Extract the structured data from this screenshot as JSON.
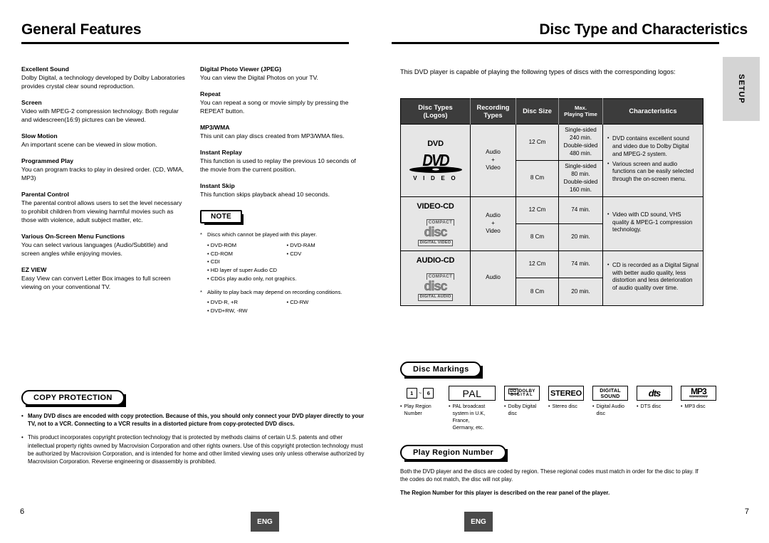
{
  "left_page": {
    "title": "General Features",
    "page_number": "6",
    "lang_tag": "ENG",
    "column1": [
      {
        "heading": "Excellent Sound",
        "body": "Dolby Digital, a technology developed by Dolby Laboratories provides crystal clear sound reproduction."
      },
      {
        "heading": "Screen",
        "body": "Video with MPEG-2 compression technology. Both regular and widescreen(16:9) pictures can be viewed."
      },
      {
        "heading": "Slow Motion",
        "body": "An important scene can be viewed in slow motion."
      },
      {
        "heading": "Programmed Play",
        "body": "You can program tracks to play in desired order. (CD, WMA, MP3)"
      },
      {
        "heading": "Parental Control",
        "body": "The parental control allows users to set the level necessary to prohibit children from viewing harmful movies such as those with violence, adult subject matter, etc."
      },
      {
        "heading": "Various On-Screen Menu Functions",
        "body": "You can select various languages (Audio/Subtitle) and screen angles while enjoying movies."
      },
      {
        "heading": "EZ VIEW",
        "body": "Easy View can convert Letter Box images to full screen viewing on your conventional TV."
      }
    ],
    "column2": [
      {
        "heading": "Digital Photo Viewer (JPEG)",
        "body": "You can view the Digital Photos on your TV."
      },
      {
        "heading": "Repeat",
        "body": "You can repeat a song or movie simply by pressing the REPEAT button."
      },
      {
        "heading": "MP3/WMA",
        "body": "This unit can play discs created from MP3/WMA files."
      },
      {
        "heading": "Instant Replay",
        "body": "This function is used to replay the previous 10 seconds of the movie from the current position."
      },
      {
        "heading": "Instant Skip",
        "body": "This function skips playback ahead 10 seconds."
      }
    ],
    "note": {
      "label": "NOTE",
      "star1": "Discs which cannot be played with this player.",
      "list1": [
        "DVD-ROM",
        "DVD-RAM",
        "CD-ROM",
        "CDV",
        "CDI"
      ],
      "list1_full": [
        "HD layer of super Audio CD",
        "CDGs play audio only, not graphics."
      ],
      "star2": "Ability to play back may depend on recording conditions.",
      "list2": [
        "DVD-R, +R",
        "CD-RW",
        "DVD+RW, -RW"
      ]
    },
    "copy_protection": {
      "label": "COPY PROTECTION",
      "item1": "Many DVD discs are encoded with copy protection. Because of this, you should only connect your DVD player directly to your TV, not to a VCR. Connecting to a VCR results in a distorted picture from copy-protected DVD discs.",
      "item2": "This product incorporates copyright protection technology that is protected by methods claims of certain U.S. patents and other intellectual property rights owned by Macrovision Corporation and other rights owners. Use of this copyright protection technology must be authorized by Macrovision Corporation, and is intended for home and other limited viewing uses only unless otherwise authorized by Macrovision Corporation. Reverse engineering or disassembly is prohibited."
    }
  },
  "right_page": {
    "title": "Disc Type and Characteristics",
    "page_number": "7",
    "lang_tag": "ENG",
    "setup_tab": "SETUP",
    "intro": "This DVD player is capable of playing the following types of discs with the corresponding logos:",
    "table": {
      "headers": {
        "c1_line1": "Disc Types",
        "c1_line2": "(Logos)",
        "c2_line1": "Recording",
        "c2_line2": "Types",
        "c3": "Disc Size",
        "c4_line1": "Max.",
        "c4_line2": "Playing Time",
        "c5": "Characteristics"
      },
      "rows": [
        {
          "disc_type": "DVD",
          "logo_main": "DVD",
          "logo_sub": "V I D E O",
          "recording_types": [
            "Audio",
            "+",
            "Video"
          ],
          "sizes": [
            {
              "size": "12 Cm",
              "time": "Single-sided\n240 min.\nDouble-sided\n480 min."
            },
            {
              "size": "8 Cm",
              "time": "Single-sided\n80 min.\nDouble-sided\n160 min."
            }
          ],
          "characteristics": [
            "DVD contains excellent sound and video due to Dolby Digital and MPEG-2 system.",
            "Various screen and audio functions can be easily selected through the on-screen menu."
          ]
        },
        {
          "disc_type": "VIDEO-CD",
          "logo_compact": "COMPACT",
          "logo_disc": "disc",
          "logo_sub": "DIGITAL VIDEO",
          "recording_types": [
            "Audio",
            "+",
            "Video"
          ],
          "sizes": [
            {
              "size": "12 Cm",
              "time": "74 min."
            },
            {
              "size": "8 Cm",
              "time": "20 min."
            }
          ],
          "characteristics": [
            "Video with CD sound, VHS quality & MPEG-1 compression technology."
          ]
        },
        {
          "disc_type": "AUDIO-CD",
          "logo_compact": "COMPACT",
          "logo_disc": "disc",
          "logo_sub": "DIGITAL AUDIO",
          "recording_types": [
            "Audio"
          ],
          "sizes": [
            {
              "size": "12 Cm",
              "time": "74 min."
            },
            {
              "size": "8 Cm",
              "time": "20 min."
            }
          ],
          "characteristics": [
            "CD is recorded as a Digital Signal with better audio quality, less distortion and less deterioration of audio quality over time."
          ]
        }
      ]
    },
    "disc_markings": {
      "label": "Disc Markings",
      "items": [
        {
          "icon": "region-number-icon",
          "icon_text": "1 ~ 6",
          "caption": "Play Region Number"
        },
        {
          "icon": "pal-icon",
          "icon_text": "PAL",
          "caption": "PAL broadcast system in U.K, France, Germany, etc."
        },
        {
          "icon": "dolby-digital-icon",
          "icon_text": "DOLBY DIGITAL",
          "caption": "Dolby Digital disc"
        },
        {
          "icon": "stereo-icon",
          "icon_text": "STEREO",
          "caption": "Stereo disc"
        },
        {
          "icon": "digital-sound-icon",
          "icon_text": "DIGITAL SOUND",
          "caption": "Digital Audio disc"
        },
        {
          "icon": "dts-icon",
          "icon_text": "dts",
          "caption": "DTS disc"
        },
        {
          "icon": "mp3-icon",
          "icon_text": "MP3",
          "caption": "MP3 disc"
        }
      ]
    },
    "play_region": {
      "label": "Play Region Number",
      "body": "Both the DVD player and the discs are coded by region. These regional codes must match in order for the disc to play. If the codes do not match, the disc will not play.",
      "bold": "The Region Number for this player is described on the rear panel of the player."
    }
  },
  "colors": {
    "table_header_bg": "#3c3c3c",
    "table_cell_bg": "#e6e6e6",
    "setup_tab_bg": "#d4d4d4",
    "lang_tag_bg": "#4a4a4a",
    "text": "#000000"
  }
}
